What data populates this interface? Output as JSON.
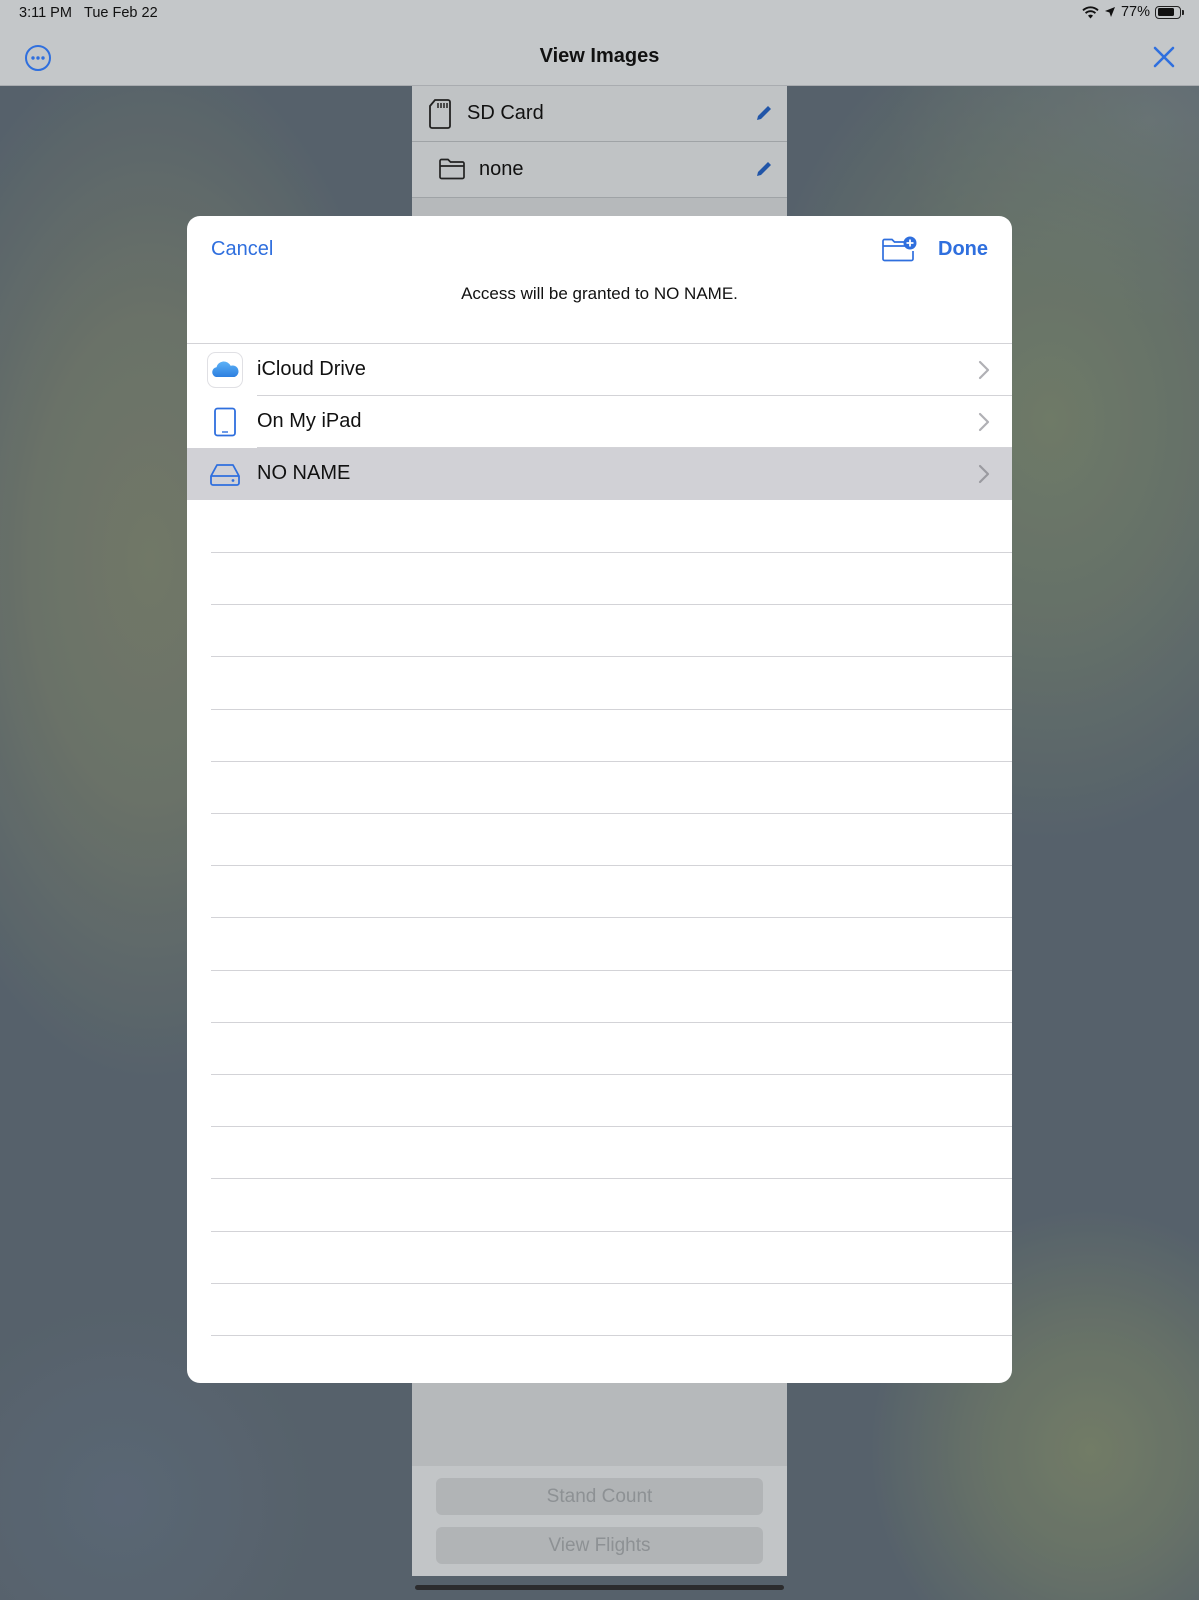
{
  "status_bar": {
    "time": "3:11 PM",
    "date": "Tue Feb 22",
    "battery": "77%",
    "battery_level": 0.77
  },
  "nav": {
    "title": "View Images",
    "more_icon": "ellipsis-circle-icon",
    "close_icon": "close-icon"
  },
  "panel": {
    "rows": [
      {
        "label": "SD Card",
        "icon": "sd-card-icon"
      },
      {
        "label": "none",
        "icon": "folder-icon"
      }
    ],
    "buttons": {
      "stand_count": "Stand Count",
      "view_flights": "View Flights"
    }
  },
  "picker": {
    "cancel": "Cancel",
    "done": "Done",
    "message": "Access will be granted to NO NAME.",
    "locations": [
      {
        "label": "iCloud Drive",
        "icon": "icloud-icon"
      },
      {
        "label": "On My iPad",
        "icon": "ipad-icon"
      },
      {
        "label": "NO NAME",
        "icon": "external-drive-icon",
        "selected": true
      }
    ]
  },
  "colors": {
    "accent": "#2f6fde",
    "selected_row": "#d1d1d6"
  }
}
